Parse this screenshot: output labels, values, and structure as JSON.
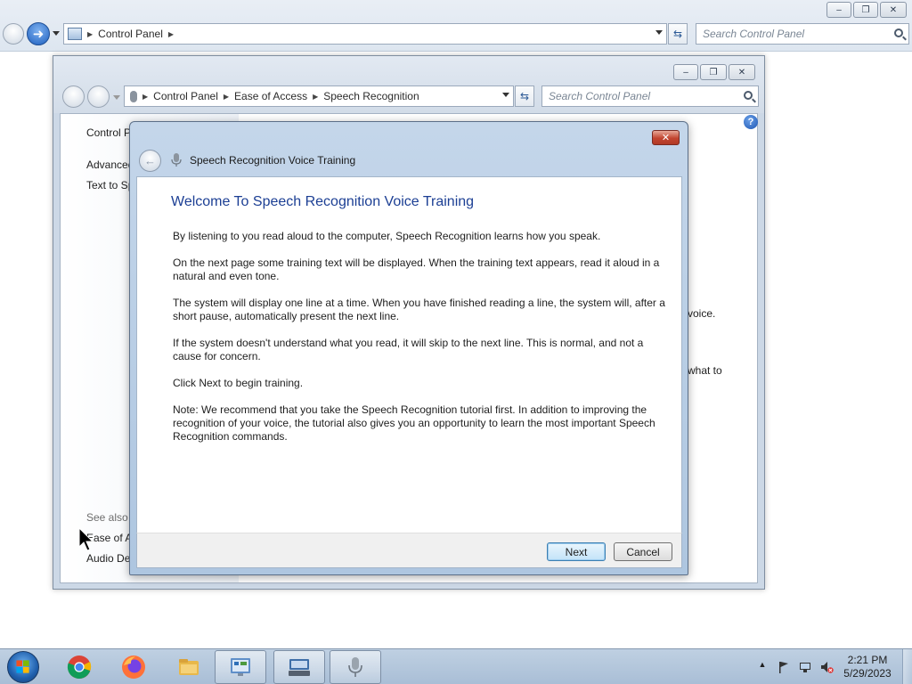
{
  "outer_window": {
    "address": {
      "crumbs": [
        "Control Panel"
      ]
    },
    "search_placeholder": "Search Control Panel",
    "caption_icons": {
      "minimize": "–",
      "restore": "❐",
      "close": "✕"
    }
  },
  "inner_window": {
    "address": {
      "crumbs": [
        "Control Panel",
        "Ease of Access",
        "Speech Recognition"
      ]
    },
    "search_placeholder": "Search Control Panel",
    "left_links": [
      "Control P",
      "Advanced",
      "Text to Sp"
    ],
    "see_also_label": "See also",
    "see_also_links": [
      "Ease of A",
      "Audio De"
    ],
    "right_fragments": [
      "voice.",
      "what to"
    ]
  },
  "dialog": {
    "title": "Speech Recognition Voice Training",
    "heading": "Welcome To Speech Recognition Voice Training",
    "paragraphs": [
      "By listening to you read aloud to the computer, Speech Recognition learns how you speak.",
      "On the next page some training text will be displayed. When the training text appears, read it aloud in a natural and even tone.",
      "The system will display one line at a time. When you have finished reading a line, the system will, after a short pause, automatically present the next line.",
      "If the system doesn't understand what you read, it will skip to the next line. This is normal, and not a cause for concern.",
      "Click Next to begin training.",
      "Note: We recommend that you take the Speech Recognition tutorial first. In addition to improving the recognition of your voice, the tutorial also gives you an opportunity to learn the most important Speech Recognition commands."
    ],
    "buttons": {
      "next": "Next",
      "cancel": "Cancel"
    }
  },
  "taskbar": {
    "clock": {
      "time": "2:21 PM",
      "date": "5/29/2023"
    },
    "items": [
      "start-orb",
      "chrome-icon",
      "firefox-icon",
      "file-explorer-icon",
      "control-panel-icon",
      "on-screen-keyboard-icon",
      "speech-recognition-icon"
    ]
  },
  "colors": {
    "accent_heading": "#1c3f94",
    "dialog_frame": "#aec6e0",
    "close_red": "#c24530"
  }
}
